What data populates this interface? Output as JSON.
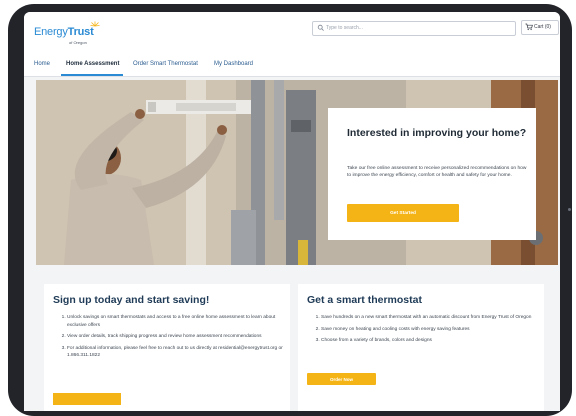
{
  "brand": {
    "name_part1": "Energy",
    "name_part2": "Trust",
    "tagline": "of Oregon",
    "accent": "#2a8ad3",
    "button_color": "#f5b416"
  },
  "header": {
    "search_placeholder": "Type to search...",
    "cart_label": "Cart (0)"
  },
  "nav": {
    "tabs": [
      {
        "label": "Home",
        "active": false
      },
      {
        "label": "Home Assessment",
        "active": true
      },
      {
        "label": "Order Smart Thermostat",
        "active": false
      },
      {
        "label": "My Dashboard",
        "active": false
      }
    ]
  },
  "hero": {
    "title": "Interested in improving your home?",
    "body": "Take our free online assessment to receive personalized recommendations on how to improve the energy efficiency, comfort or health and safety for your home.",
    "cta_label": "Get Started"
  },
  "signup": {
    "title": "Sign up today and start saving!",
    "items": [
      "Unlock savings on smart thermostats and access to a free online home assessment to learn about exclusive offers",
      "View order details, track shipping progress and review home assessment recommendations",
      "For additional information, please feel free to reach out to us directly at residential@energytrust.org or 1.866.311.1822"
    ]
  },
  "thermostat": {
    "title": "Get a smart thermostat",
    "items": [
      "Save hundreds on a new smart thermostat with an automatic discount from Energy Trust of Oregon",
      "Save money on heating and cooling costs with energy saving features",
      "Choose from a variety of brands, colors and designs"
    ],
    "cta_label": "Order Now"
  }
}
